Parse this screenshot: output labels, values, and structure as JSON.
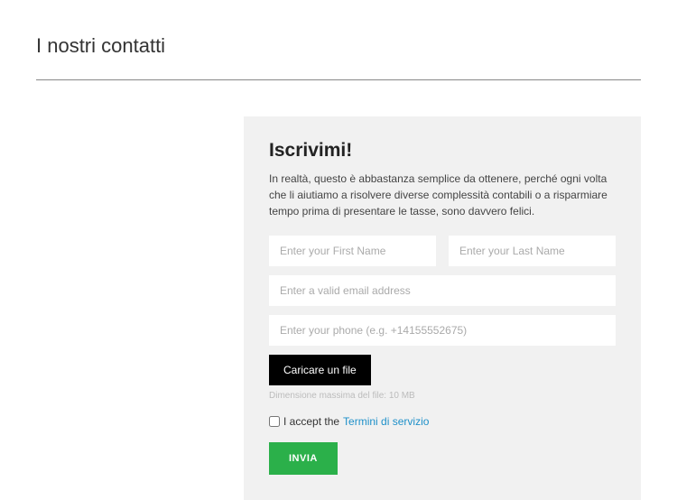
{
  "header": {
    "title": "I nostri contatti"
  },
  "form": {
    "title": "Iscrivimi!",
    "description": "In realtà, questo è abbastanza semplice da ottenere, perché ogni volta che li aiutiamo a risolvere diverse complessità contabili o a risparmiare tempo prima di presentare le tasse, sono davvero felici.",
    "first_name_placeholder": "Enter your First Name",
    "last_name_placeholder": "Enter your Last Name",
    "email_placeholder": "Enter a valid email address",
    "phone_placeholder": "Enter your phone (e.g. +14155552675)",
    "file_button": "Caricare un file",
    "file_hint": "Dimensione massima del file: 10 MB",
    "accept_prefix": "I accept the ",
    "tos_link_label": "Termini di servizio",
    "submit_label": "INVIA"
  }
}
